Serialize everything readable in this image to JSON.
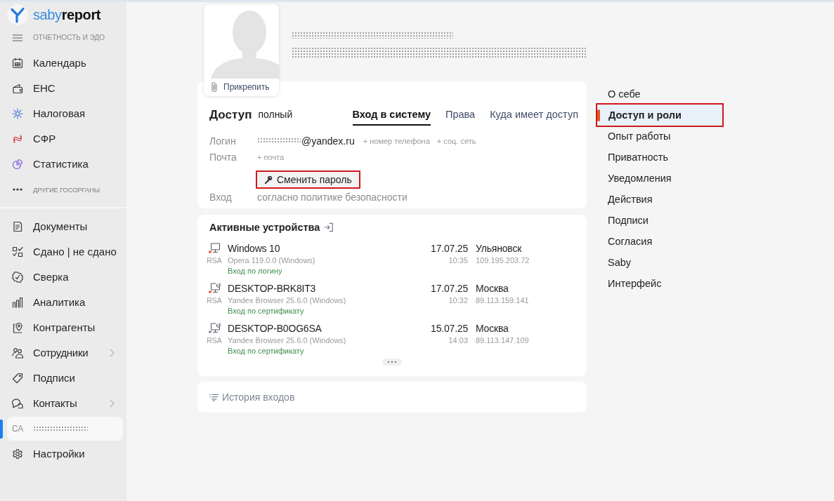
{
  "sidebar": {
    "logo": "saby**report**",
    "section_title": "ОТЧЕТНОСТЬ И ЭДО",
    "reporting_items": [
      {
        "label": "Календарь",
        "selected": false
      },
      {
        "label": "ЕНС",
        "selected": false
      },
      {
        "label": "Налоговая",
        "selected": false
      },
      {
        "label": "СФР",
        "selected": false
      },
      {
        "label": "Статистика",
        "selected": false
      }
    ],
    "more_label": "ДРУГИЕ ГОСОРГАНЫ",
    "main_items": [
      {
        "kind": "link",
        "label": "Документы",
        "has_submenu": false,
        "selected": false
      },
      {
        "kind": "link",
        "label": "Сдано | не сдано",
        "has_submenu": false,
        "selected": false
      },
      {
        "kind": "link",
        "label": "Сверка",
        "has_submenu": false,
        "selected": false
      },
      {
        "kind": "link",
        "label": "Аналитика",
        "has_submenu": false,
        "selected": false
      },
      {
        "kind": "link",
        "label": "Контрагенты",
        "has_submenu": false,
        "selected": false
      },
      {
        "kind": "link",
        "label": "Сотрудники",
        "has_submenu": true,
        "selected": false
      },
      {
        "kind": "link",
        "label": "Подписи",
        "has_submenu": false,
        "selected": false
      },
      {
        "kind": "link",
        "label": "Контакты",
        "has_submenu": true,
        "selected": false
      },
      {
        "kind": "user",
        "initials": "CA",
        "name_redacted": true,
        "has_submenu": false,
        "selected": true
      },
      {
        "kind": "link",
        "label": "Настройки",
        "has_submenu": false,
        "selected": false
      }
    ]
  },
  "profile": {
    "attach_label": "Прикрепить",
    "subtitle_redacted": true,
    "name_redacted": true
  },
  "access": {
    "title": "Доступ",
    "access_type": "полный",
    "tabs": [
      {
        "label": "Вход в систему",
        "selected": true
      },
      {
        "label": "Права",
        "selected": false
      },
      {
        "label": "Куда имеет доступ",
        "selected": false
      }
    ],
    "fields": [
      {
        "label": "Логин",
        "value_redacted": true,
        "value": "@yandex.ru",
        "links": [
          "+ номер телефона",
          "+ соц. сеть"
        ]
      },
      {
        "label": "Почта",
        "value_redacted": false,
        "links": [
          "+ почта"
        ]
      }
    ],
    "change_password": {
      "label": "Сменить пароль",
      "highlighted": true
    },
    "entry": {
      "label": "Вход",
      "value": "согласно политике безопасности"
    }
  },
  "devices": {
    "title": "Активные устройства",
    "items": [
      {
        "kind": "monitor",
        "color": "#ee6436",
        "key_label": "RSA",
        "name": "Windows 10",
        "browser": "Opera 119.0.0 (Windows)",
        "login_method": "Вход по логину",
        "date": "17.07.25",
        "time": "10:35",
        "city": "Ульяновск",
        "ip": "109.195.203.72"
      },
      {
        "kind": "monitor-sync",
        "color": "#ee6436",
        "key_label": "RSA",
        "name": "DESKTOP-BRK8IT3",
        "browser": "Yandex Browser 25.6.0 (Windows)",
        "login_method": "Вход по сертификату",
        "date": "17.07.25",
        "time": "10:32",
        "city": "Москва",
        "ip": "89.113.159.141"
      },
      {
        "kind": "monitor-sync",
        "color": "#8a93a3",
        "key_label": "RSA",
        "name": "DESKTOP-B0OG6SA",
        "browser": "Yandex Browser 25.6.0 (Windows)",
        "login_method": "Вход по сертификату",
        "date": "15.07.25",
        "time": "14:03",
        "city": "Москва",
        "ip": "89.113.147.109"
      }
    ]
  },
  "history": {
    "label": "История входов"
  },
  "sections_menu": [
    {
      "label": "О себе",
      "selected": false,
      "highlighted": false
    },
    {
      "label": "Доступ и роли",
      "selected": true,
      "highlighted": true
    },
    {
      "label": "Опыт работы",
      "selected": false,
      "highlighted": false
    },
    {
      "label": "Приватность",
      "selected": false,
      "highlighted": false
    },
    {
      "label": "Уведомления",
      "selected": false,
      "highlighted": false
    },
    {
      "label": "Действия",
      "selected": false,
      "highlighted": false
    },
    {
      "label": "Подписи",
      "selected": false,
      "highlighted": false
    },
    {
      "label": "Согласия",
      "selected": false,
      "highlighted": false
    },
    {
      "label": "Saby",
      "selected": false,
      "highlighted": false
    },
    {
      "label": "Интерфейс",
      "selected": false,
      "highlighted": false
    }
  ]
}
